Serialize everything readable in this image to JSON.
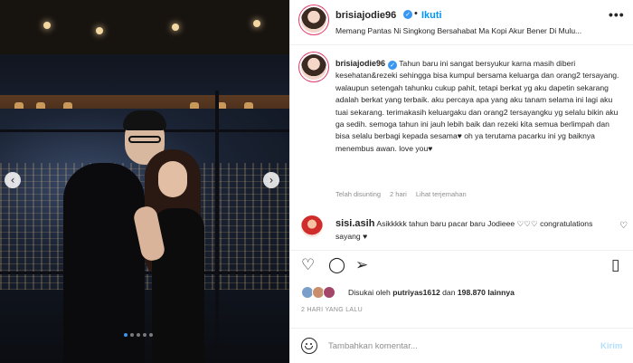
{
  "post": {
    "username": "brisiajodie96",
    "separator": "•",
    "follow_label": "Ikuti",
    "audio_subtitle": "Memang Pantas Ni Singkong Bersahabat Ma Kopi Akur Bener Di Mulu...",
    "more_glyph": "•••",
    "nav_prev": "‹",
    "nav_next": "›",
    "carousel_total": 5,
    "carousel_active": 0
  },
  "caption": {
    "username": "brisiajodie96",
    "text": "Tahun baru ini sangat bersyukur karna masih diberi kesehatan&rezeki sehingga bisa kumpul bersama keluarga dan orang2 tersayang. walaupun setengah tahunku cukup pahit, tetapi berkat yg aku dapetin sekarang adalah berkat yang terbaik. aku percaya apa yang aku tanam selama ini lagi aku tuai sekarang. terimakasih keluargaku dan orang2 tersayangku yg selalu bikin aku ga sedih. semoga tahun ini jauh lebih baik dan rezeki kita semua berlimpah dan bisa selalu berbagi kepada sesama♥︎ oh ya terutama pacarku ini yg baiknya menembus awan. love you♥︎",
    "meta": {
      "edited": "Telah disunting",
      "time": "2 hari",
      "translate": "Lihat terjemahan"
    }
  },
  "comment": {
    "username": "sisi.asih",
    "text": "Asikkkkk tahun baru pacar baru Jodieee ♡♡♡ congratulations sayang ♥︎"
  },
  "actions": {
    "like_icon": "♡",
    "comment_icon": "◯",
    "share_icon": "➢",
    "save_icon": "▯"
  },
  "likes": {
    "prefix": "Disukai oleh",
    "user": "putriyas1612",
    "connector": "dan",
    "count": "198.870 lainnya"
  },
  "date": "2 HARI YANG LALU",
  "compose": {
    "placeholder": "Tambahkan komentar...",
    "send_label": "Kirim"
  },
  "colors": {
    "link_blue": "#0095f6",
    "verified_blue": "#3897f0",
    "muted": "#8e8e8e",
    "send_disabled": "#b2dffc"
  }
}
